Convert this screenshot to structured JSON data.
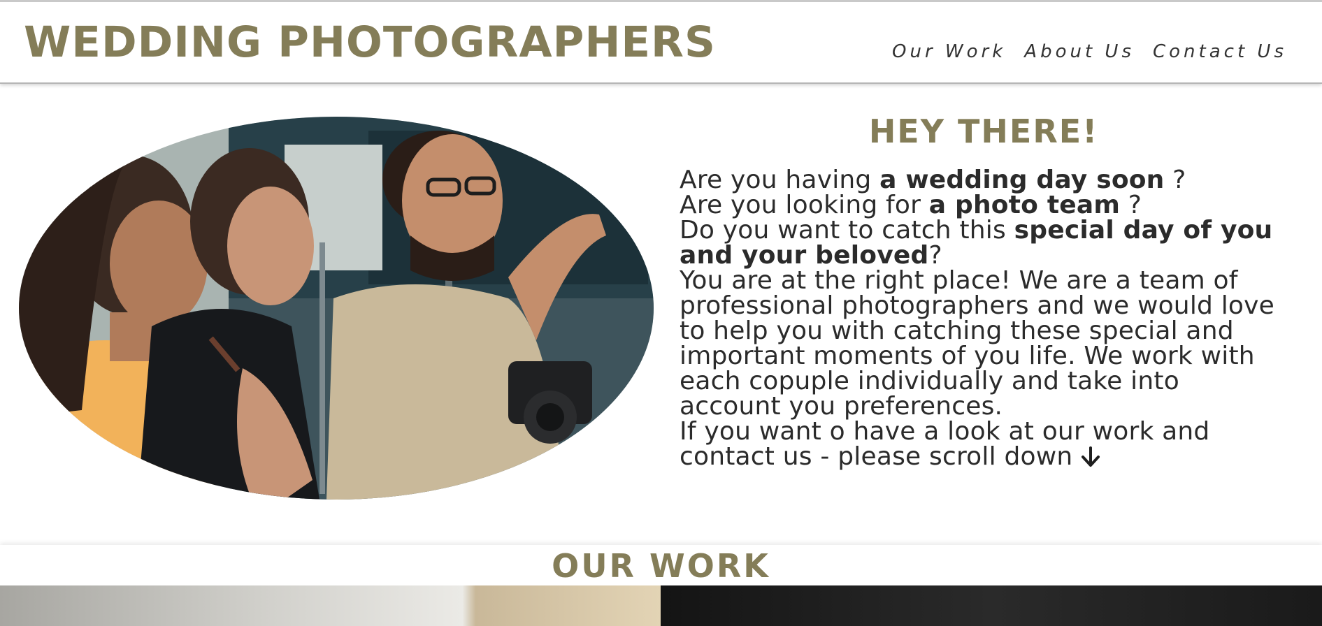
{
  "header": {
    "site_title": "WEDDING PHOTOGRAPHERS",
    "nav": [
      {
        "label": "Our Work"
      },
      {
        "label": "About Us"
      },
      {
        "label": "Contact Us"
      }
    ]
  },
  "intro": {
    "heading": "HEY THERE!",
    "line1_pre": "Are you having ",
    "line1_bold": "a wedding day soon",
    "line1_post": " ?",
    "line2_pre": "Are you looking for ",
    "line2_bold": "a photo team",
    "line2_post": " ?",
    "line3_pre": "Do you want to catch this ",
    "line3_bold": "special day of you and your beloved",
    "line3_post": "?",
    "paragraph": "You are at the right place! We are a team of professional photographers and we would love to help you with catching these special and important moments of you life. We work with each copuple individually and take into account you preferences.",
    "closing": "If you want o have a look at our work and contact us - please scroll down",
    "arrow_icon": "arrow-down-icon"
  },
  "our_work": {
    "title": "OUR WORK"
  },
  "colors": {
    "accent": "#847d58",
    "text": "#2b2b2b"
  }
}
